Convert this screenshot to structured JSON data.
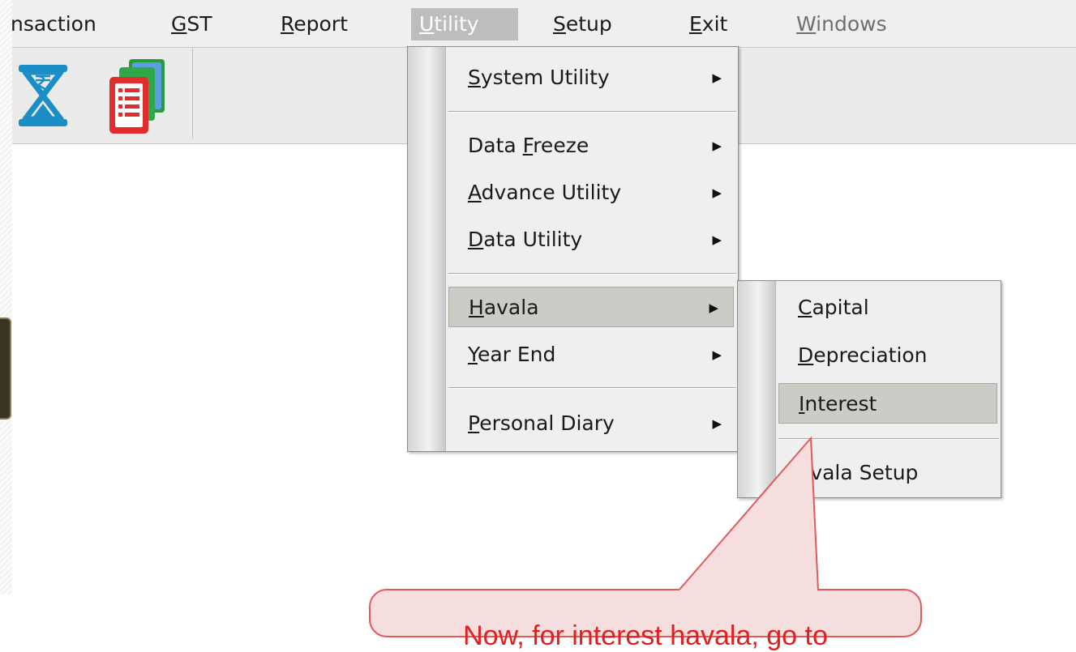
{
  "menubar": {
    "items": [
      {
        "label": "nsaction",
        "mnemonic": ""
      },
      {
        "label": "ST",
        "mnemonic": "G"
      },
      {
        "label": "eport",
        "mnemonic": "R"
      },
      {
        "label": "tility",
        "mnemonic": "U"
      },
      {
        "label": "etup",
        "mnemonic": "S"
      },
      {
        "label": "xit",
        "mnemonic": "E"
      },
      {
        "label": "indows",
        "mnemonic": "W"
      }
    ]
  },
  "toolbar": {
    "icons": [
      "hourglass-rupee-icon",
      "documents-stack-icon"
    ]
  },
  "utility_menu": {
    "items": [
      {
        "before": "",
        "mnemonic": "S",
        "after": "ystem Utility",
        "arrow": "▶"
      },
      {
        "before": "Data ",
        "mnemonic": "F",
        "after": "reeze",
        "arrow": "▶"
      },
      {
        "before": "",
        "mnemonic": "A",
        "after": "dvance Utility",
        "arrow": "▶"
      },
      {
        "before": "",
        "mnemonic": "D",
        "after": "ata Utility",
        "arrow": "▶"
      },
      {
        "before": "",
        "mnemonic": "H",
        "after": "avala",
        "arrow": "▶"
      },
      {
        "before": "",
        "mnemonic": "Y",
        "after": "ear End",
        "arrow": "▶"
      },
      {
        "before": "",
        "mnemonic": "P",
        "after": "ersonal Diary",
        "arrow": "▶"
      }
    ]
  },
  "havala_menu": {
    "items": [
      {
        "mnemonic": "C",
        "after": "apital"
      },
      {
        "mnemonic": "D",
        "after": "epreciation"
      },
      {
        "mnemonic": "I",
        "after": "nterest"
      },
      {
        "mnemonic": "",
        "after": "avala Setup"
      }
    ]
  },
  "callout": {
    "text": "Now, for interest havala, go to"
  },
  "colors": {
    "callout_fill": "#f7dede",
    "callout_border": "#e05a5a",
    "callout_text": "#e02020",
    "menu_highlight": "#cdcbc6"
  }
}
